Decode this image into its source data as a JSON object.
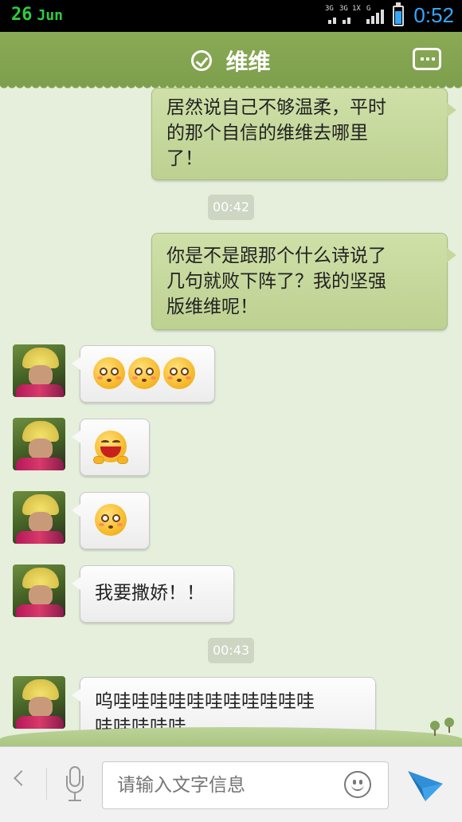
{
  "status_bar": {
    "date_day": "26",
    "date_month": "Jun",
    "network_labels": [
      "3G",
      "3G",
      "1X",
      "G"
    ],
    "time": "0:52",
    "battery_color": "#35a7ff"
  },
  "header": {
    "title": "维维",
    "verified_icon": "check-circle-icon",
    "more_icon": "more-icon",
    "color": "#7e9f4c"
  },
  "messages": [
    {
      "type": "outgoing",
      "lines": [
        "居然说自己不够温柔，平时",
        "的那个自信的维维去哪里",
        "了！"
      ]
    },
    {
      "type": "timestamp",
      "text": "00:42"
    },
    {
      "type": "outgoing",
      "lines": [
        "你是不是跟那个什么诗说了",
        "几句就败下阵了？我的坚强",
        "版维维呢！"
      ]
    },
    {
      "type": "incoming",
      "emojis": [
        "pout-emoji",
        "pout-emoji",
        "pout-emoji"
      ]
    },
    {
      "type": "incoming",
      "emojis": [
        "grin-emoji"
      ]
    },
    {
      "type": "incoming",
      "emojis": [
        "pout-emoji"
      ]
    },
    {
      "type": "incoming",
      "lines": [
        "我要撒娇！！"
      ]
    },
    {
      "type": "timestamp",
      "text": "00:43"
    },
    {
      "type": "incoming",
      "lines": [
        "呜哇哇哇哇哇哇哇哇哇哇哇",
        "哇哇哇哇哇"
      ]
    }
  ],
  "input_bar": {
    "placeholder": "请输入文字信息",
    "back_icon": "chevron-left-icon",
    "mic_icon": "microphone-icon",
    "emoji_icon": "smiley-icon",
    "send_icon": "send-icon",
    "send_color": "#2f8fd8"
  }
}
